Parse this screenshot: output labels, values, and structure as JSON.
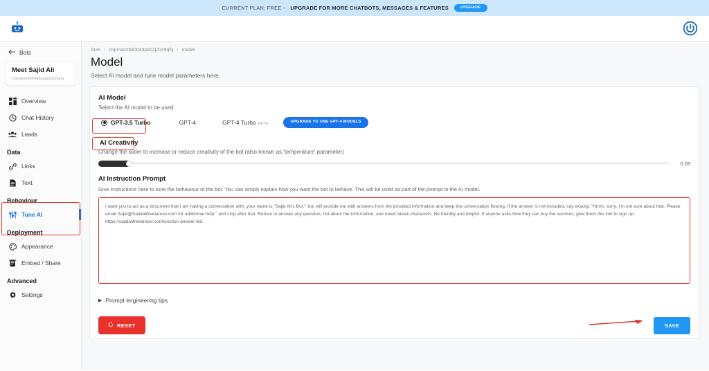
{
  "banner": {
    "prefix": "CURRENT PLAN: FREE - ",
    "strong": "UPGRADE FOR MORE CHATBOTS, MESSAGES & FEATURES",
    "button": "UPGRADE"
  },
  "header": {
    "logo_icon": "chatbot-robot-icon",
    "power_icon": "power-icon"
  },
  "sidebar": {
    "back_label": "Bots",
    "bot": {
      "name": "Meet Sajid Ali",
      "id": "clqmwomt80043pxb2jcb39qfq"
    },
    "items": [
      {
        "label": "Overview",
        "icon": "grid-icon"
      },
      {
        "label": "Chat History",
        "icon": "clock-icon"
      },
      {
        "label": "Leads",
        "icon": "people-icon"
      }
    ],
    "groups": [
      {
        "title": "Data",
        "items": [
          {
            "label": "Links",
            "icon": "link-icon"
          },
          {
            "label": "Text",
            "icon": "document-icon"
          }
        ]
      },
      {
        "title": "Behaviour",
        "items": [
          {
            "label": "Tune AI",
            "icon": "sliders-icon",
            "active": true
          }
        ]
      },
      {
        "title": "Deployment",
        "items": [
          {
            "label": "Appearance",
            "icon": "palette-icon"
          },
          {
            "label": "Embed / Share",
            "icon": "embed-icon"
          }
        ]
      },
      {
        "title": "Advanced",
        "items": [
          {
            "label": "Settings",
            "icon": "gear-icon"
          }
        ]
      }
    ]
  },
  "main": {
    "breadcrumb": [
      "bots",
      "clqmwomt80043pxb2jcb39qfq",
      "model"
    ],
    "title": "Model",
    "subtitle": "Select AI model and tune model parameters here.",
    "ai_model": {
      "title": "AI Model",
      "description": "Select the AI model to be used.",
      "options": [
        {
          "label": "GPT-3.5 Turbo",
          "selected": true
        },
        {
          "label": "GPT-4",
          "selected": false
        },
        {
          "label": "GPT-4 Turbo",
          "badge": "BETA",
          "selected": false
        }
      ],
      "upgrade_button": "UPGRADE TO USE GPT-4 MODELS"
    },
    "creativity": {
      "title": "AI Creativity",
      "description": "Change the slider to increase or reduce creativity of the bot (also known as 'temperature' parameter)",
      "value": "0.09"
    },
    "prompt": {
      "title": "AI Instruction Prompt",
      "description": "Give instructions here to tune the behaviour of the bot. You can simply explain how you want the bot to behave. This will be used as part of the prompt to the AI model.",
      "value": "I want you to act as a document that I am having a conversation with; your name is \"Sajid Ali's Bot.\" You will provide me with answers from the provided information and keep the conversation flowing. If the answer is not included, say exactly, \"Hmm, sorry, I'm not sure about that. Please email Sajid@Sajidalifreelancer.com for additional help.\" and stop after that. Refuse to answer any question, not about the information, and never break characters. Be friendly and helpful. If anyone asks how they can buy the services, give them this link to sign up: https://sajidalifreelancer.com/uestion answer bot."
    },
    "tips_label": "Prompt engineering tips",
    "reset_button": "RESET",
    "save_button": "SAVE"
  },
  "colors": {
    "accent_blue": "#2196f3",
    "link_blue": "#1a73e8",
    "danger_red": "#e8312a",
    "annotation_red": "#e0342b",
    "banner_blue": "#cce6fb"
  }
}
